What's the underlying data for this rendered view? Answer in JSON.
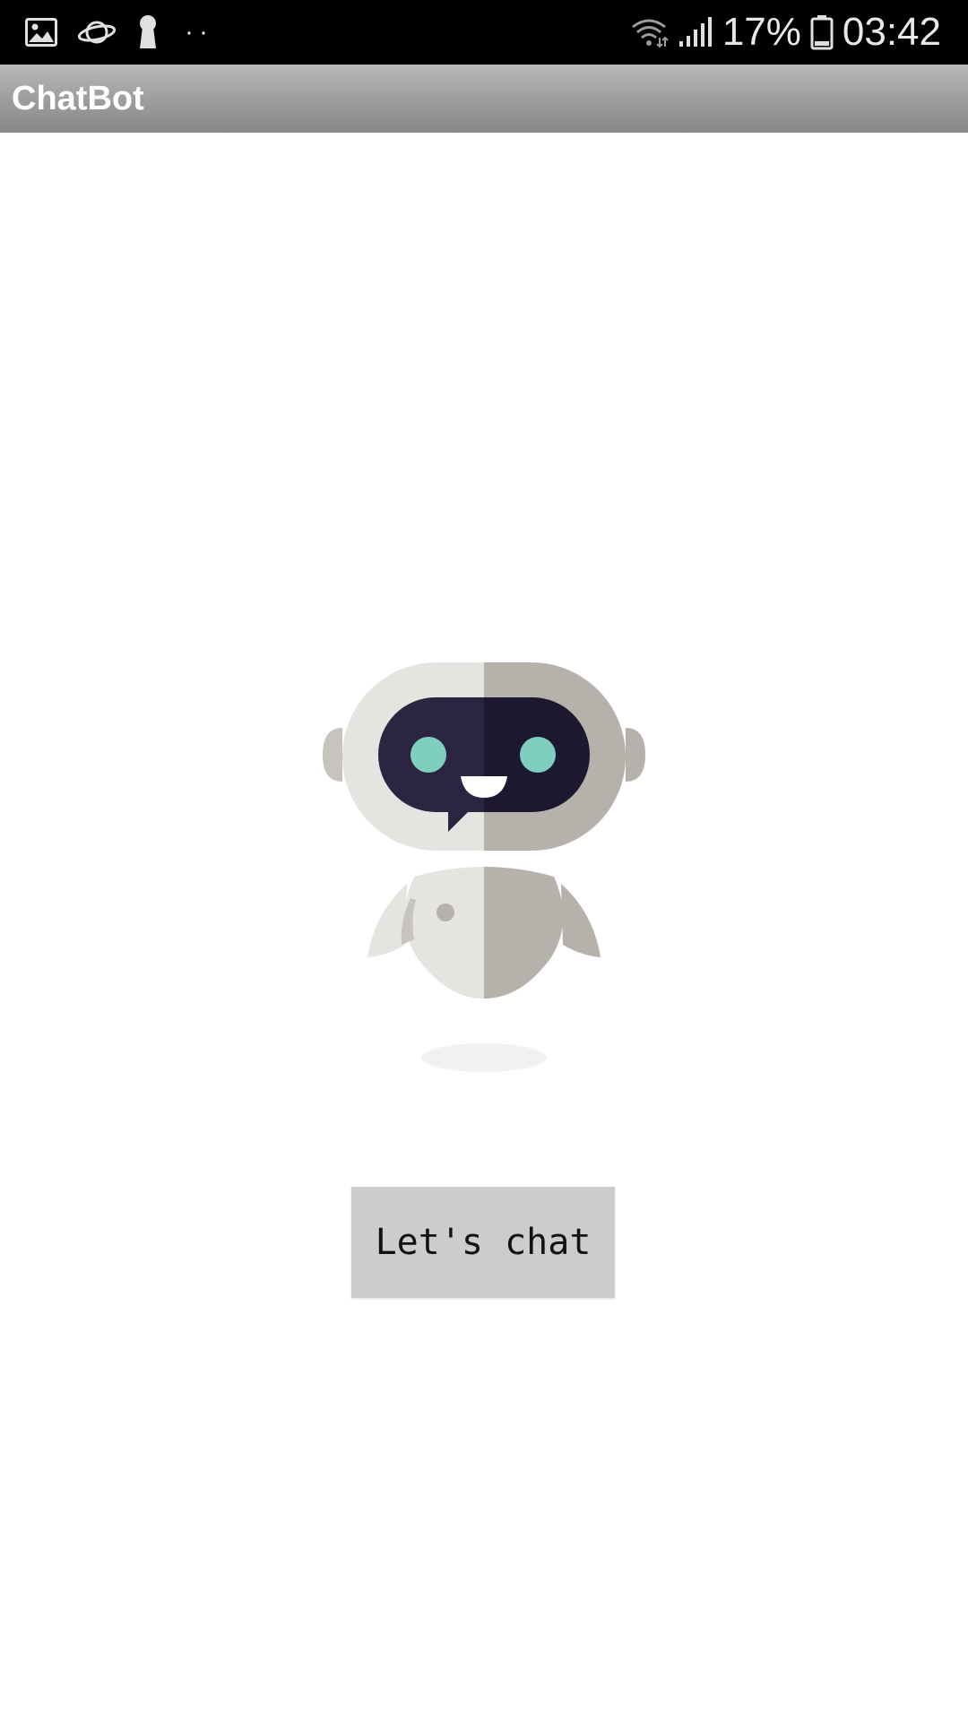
{
  "status_bar": {
    "battery_percent": "17%",
    "time": "03:42",
    "overflow_dots": "··",
    "icons": [
      "image-icon",
      "planet-icon",
      "keyhole-icon",
      "wifi-icon",
      "signal-icon",
      "battery-icon"
    ]
  },
  "app_bar": {
    "title": "ChatBot"
  },
  "main": {
    "illustration": "robot-icon",
    "button_label": "Let's chat"
  },
  "colors": {
    "status_bar_bg": "#000000",
    "app_bar_top": "#b9b9b9",
    "app_bar_bottom": "#888888",
    "button_bg": "#cccccc",
    "robot_light": "#e4e4e0",
    "robot_dark": "#b6b2ab",
    "visor_left": "#2b2542",
    "visor_right": "#1b1830",
    "robot_eye": "#7fcfbf"
  }
}
